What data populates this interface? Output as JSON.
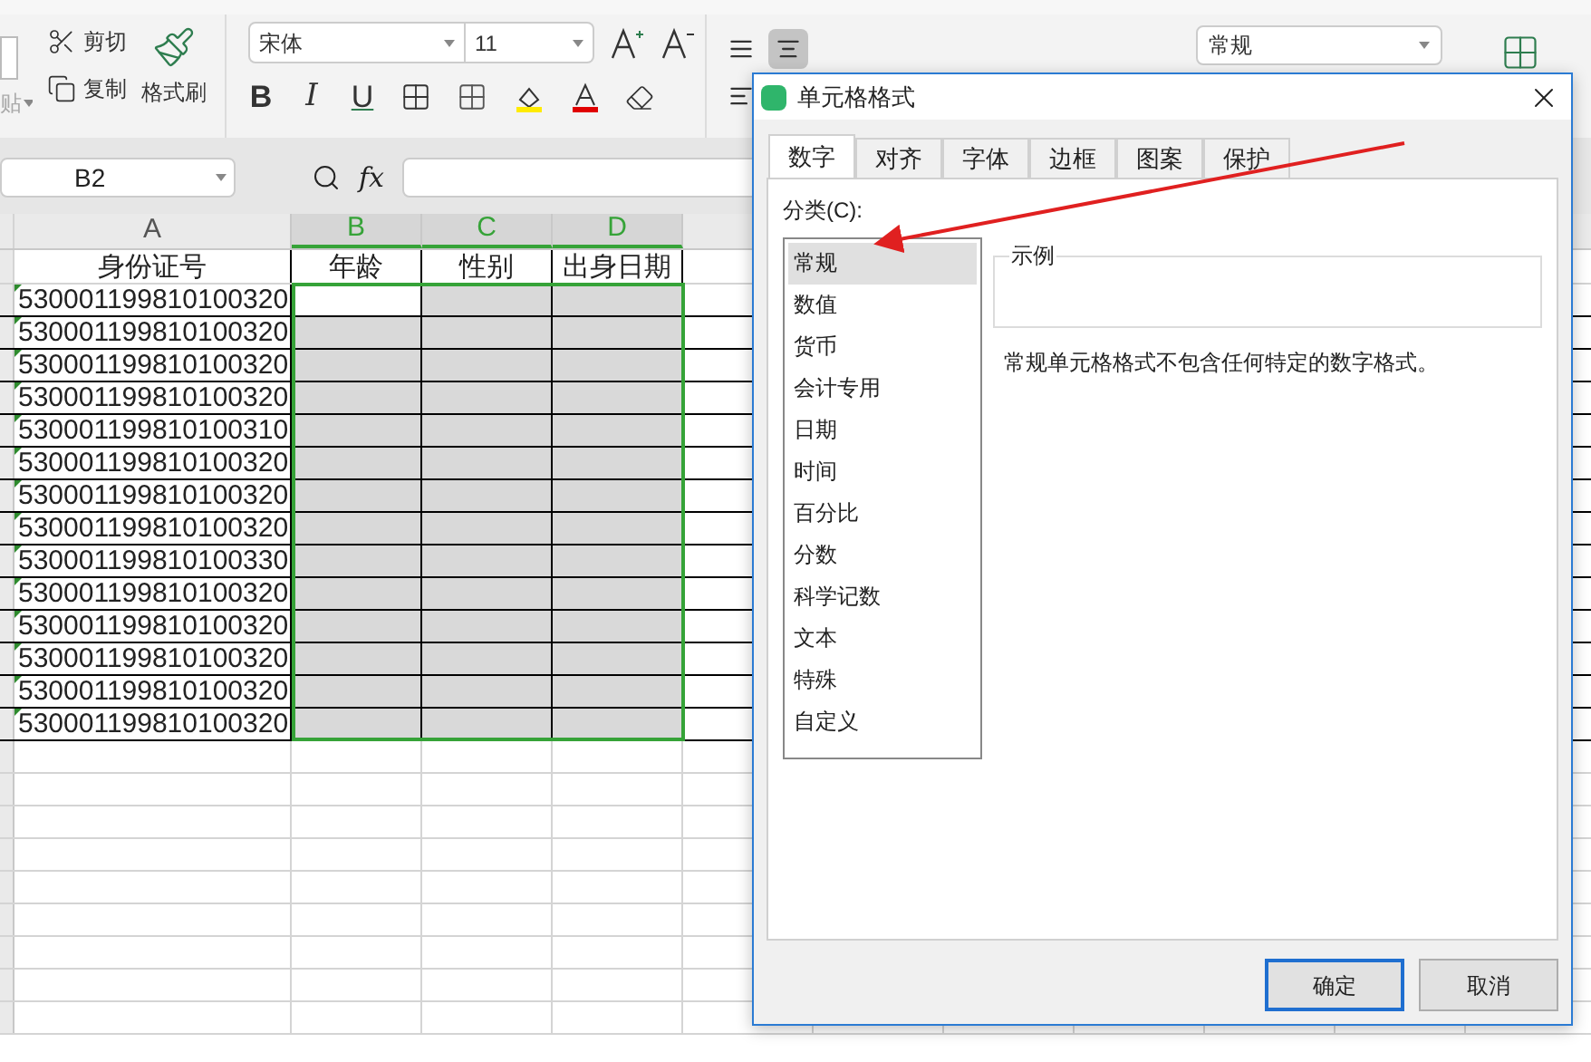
{
  "ribbon": {
    "paste_label": "贴",
    "cut": "剪切",
    "copy": "复制",
    "format_painter": "格式刷",
    "font_name": "宋体",
    "font_size": "11",
    "text_buttons": [
      "B",
      "I",
      "U"
    ],
    "number_format": "常规"
  },
  "formula_bar": {
    "name_box": "B2",
    "fx": "fx"
  },
  "sheet": {
    "columns": [
      {
        "label": "A",
        "selected": false
      },
      {
        "label": "B",
        "selected": true
      },
      {
        "label": "C",
        "selected": true
      },
      {
        "label": "D",
        "selected": true
      }
    ],
    "header_row": [
      "身份证号",
      "年龄",
      "性别",
      "出身日期"
    ],
    "rows": [
      "530001199810100320",
      "530001199810100320",
      "530001199810100320",
      "530001199810100320",
      "530001199810100310",
      "530001199810100320",
      "530001199810100320",
      "530001199810100320",
      "530001199810100330",
      "530001199810100320",
      "530001199810100320",
      "530001199810100320",
      "530001199810100320",
      "530001199810100320"
    ]
  },
  "dialog": {
    "title": "单元格格式",
    "tabs": [
      {
        "label": "数字",
        "selected": true
      },
      {
        "label": "对齐",
        "selected": false
      },
      {
        "label": "字体",
        "selected": false
      },
      {
        "label": "边框",
        "selected": false
      },
      {
        "label": "图案",
        "selected": false
      },
      {
        "label": "保护",
        "selected": false
      }
    ],
    "category_label": "分类(C):",
    "categories": [
      {
        "label": "常规",
        "selected": true
      },
      {
        "label": "数值",
        "selected": false
      },
      {
        "label": "货币",
        "selected": false
      },
      {
        "label": "会计专用",
        "selected": false
      },
      {
        "label": "日期",
        "selected": false
      },
      {
        "label": "时间",
        "selected": false
      },
      {
        "label": "百分比",
        "selected": false
      },
      {
        "label": "分数",
        "selected": false
      },
      {
        "label": "科学记数",
        "selected": false
      },
      {
        "label": "文本",
        "selected": false
      },
      {
        "label": "特殊",
        "selected": false
      },
      {
        "label": "自定义",
        "selected": false
      }
    ],
    "sample_label": "示例",
    "description": "常规单元格格式不包含任何特定的数字格式。",
    "buttons": [
      {
        "label": "确定",
        "kind": "default"
      },
      {
        "label": "取消",
        "kind": "normal"
      }
    ]
  }
}
